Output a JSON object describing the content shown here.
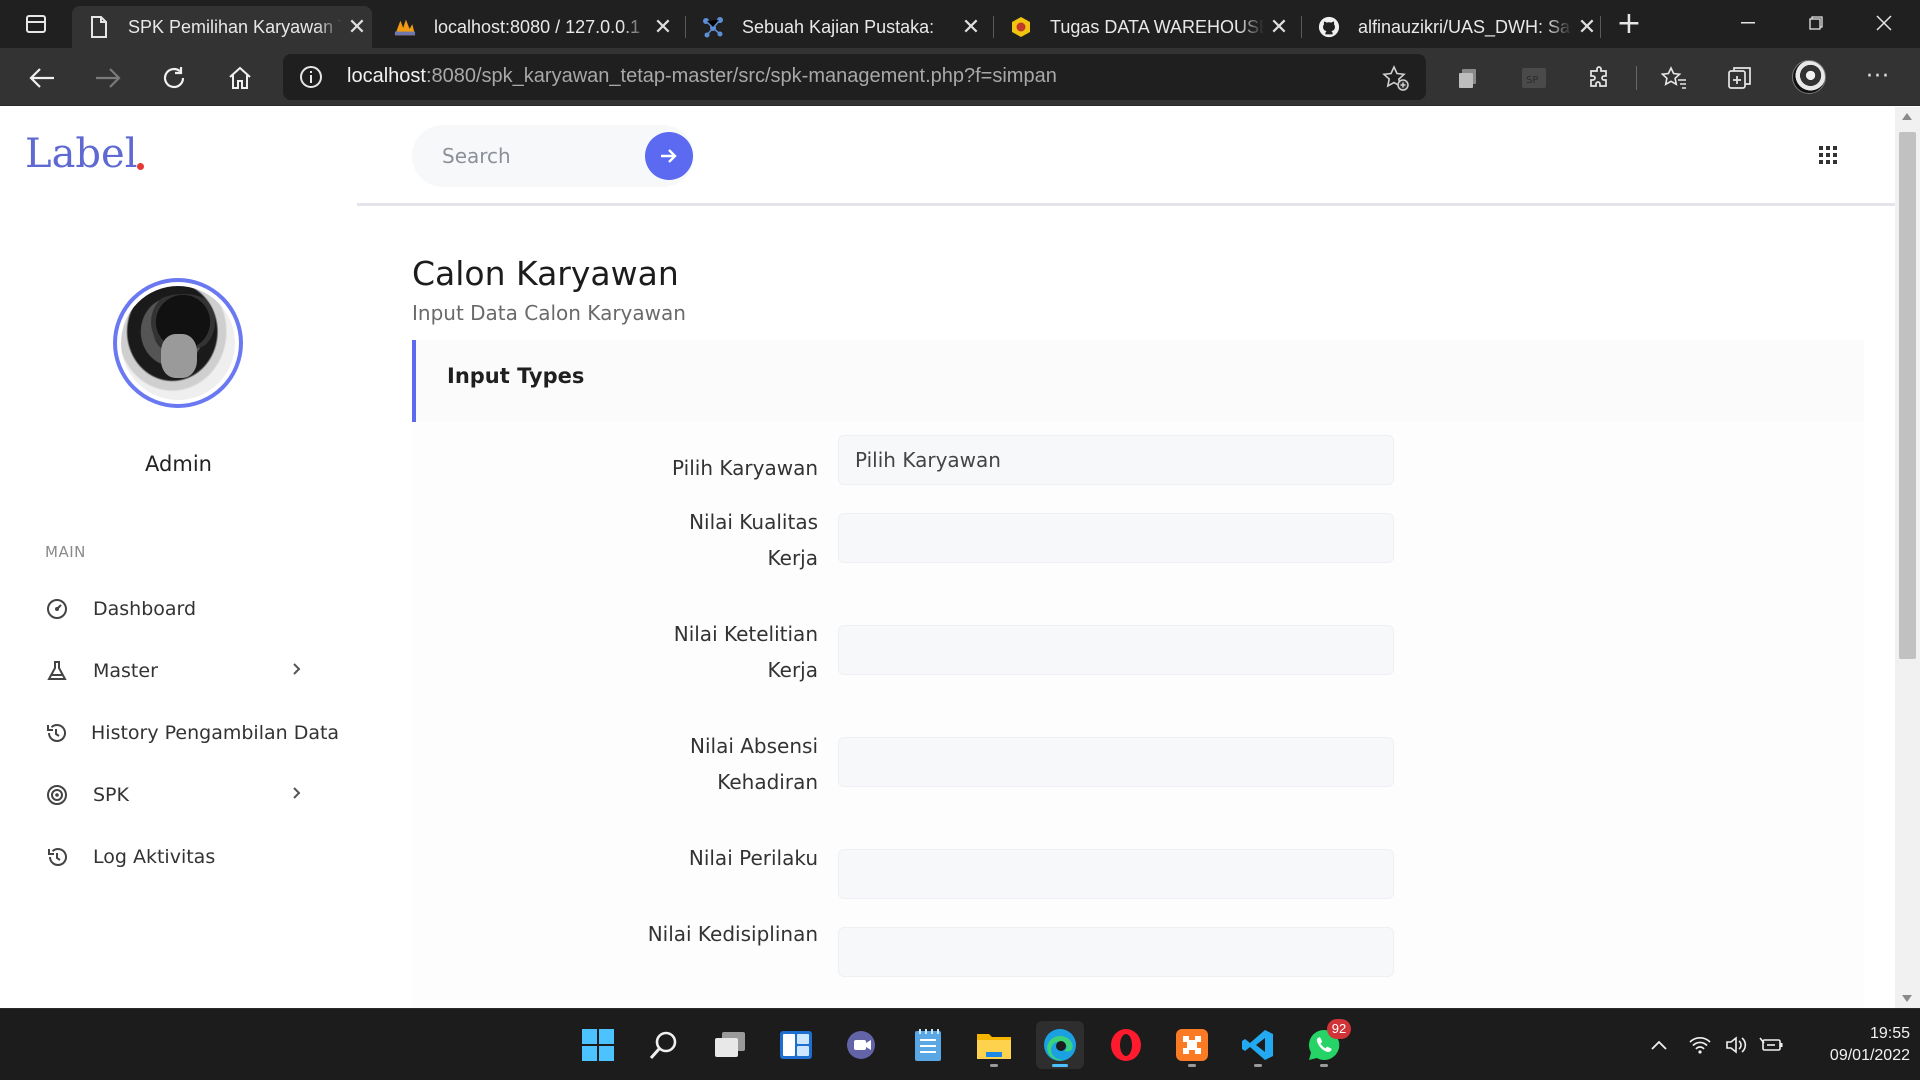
{
  "browser": {
    "tabs": [
      {
        "title": "SPK Pemilihan Karyawan Tetap",
        "icon": "page-icon",
        "active": true
      },
      {
        "title": "localhost:8080 / 127.0.0.1",
        "icon": "phpmyadmin-icon",
        "active": false
      },
      {
        "title": "Sebuah Kajian Pustaka:",
        "icon": "network-icon",
        "active": false
      },
      {
        "title": "Tugas DATA WAREHOUSE",
        "icon": "university-icon",
        "active": false
      },
      {
        "title": "alfinauzikri/UAS_DWH: Sal",
        "icon": "github-icon",
        "active": false
      }
    ],
    "url_host": "localhost",
    "url_rest": ":8080/spk_karyawan_tetap-master/src/spk-management.php?f=simpan"
  },
  "sidebar": {
    "brand": "Label",
    "user_name": "Admin",
    "section": "MAIN",
    "items": [
      {
        "label": "Dashboard",
        "icon": "dashboard-icon",
        "has_chevron": false
      },
      {
        "label": "Master",
        "icon": "flask-icon",
        "has_chevron": true
      },
      {
        "label": "History Pengambilan Data",
        "icon": "history-icon",
        "has_chevron": false
      },
      {
        "label": "SPK",
        "icon": "target-icon",
        "has_chevron": true
      },
      {
        "label": "Log Aktivitas",
        "icon": "history-icon",
        "has_chevron": false
      }
    ]
  },
  "topnav": {
    "search_placeholder": "Search"
  },
  "main": {
    "title": "Calon Karyawan",
    "subtitle": "Input Data Calon Karyawan",
    "card_title": "Input Types",
    "form": {
      "select_label": "Pilih Karyawan",
      "select_value": "Pilih Karyawan",
      "fields": [
        {
          "label_line1": "Nilai Kualitas",
          "label_line2": "Kerja",
          "value": ""
        },
        {
          "label_line1": "Nilai Ketelitian",
          "label_line2": "Kerja",
          "value": ""
        },
        {
          "label_line1": "Nilai Absensi",
          "label_line2": "Kehadiran",
          "value": ""
        },
        {
          "label_line1": "Nilai Perilaku",
          "label_line2": "",
          "value": ""
        },
        {
          "label_line1": "Nilai Kedisiplinan",
          "label_line2": "",
          "value": ""
        }
      ]
    }
  },
  "taskbar": {
    "apps": [
      "windows-start-icon",
      "search-icon",
      "task-view-icon",
      "widgets-icon",
      "teams-chat-icon",
      "notepad-icon",
      "file-explorer-icon",
      "edge-icon",
      "opera-icon",
      "xampp-icon",
      "vscode-icon",
      "whatsapp-icon"
    ],
    "whatsapp_badge": "92",
    "time": "19:55",
    "date": "09/01/2022"
  },
  "colors": {
    "accent": "#5b6af0",
    "brand_dot": "#e53935",
    "chrome_dark": "#202020",
    "toolbar": "#333333"
  }
}
